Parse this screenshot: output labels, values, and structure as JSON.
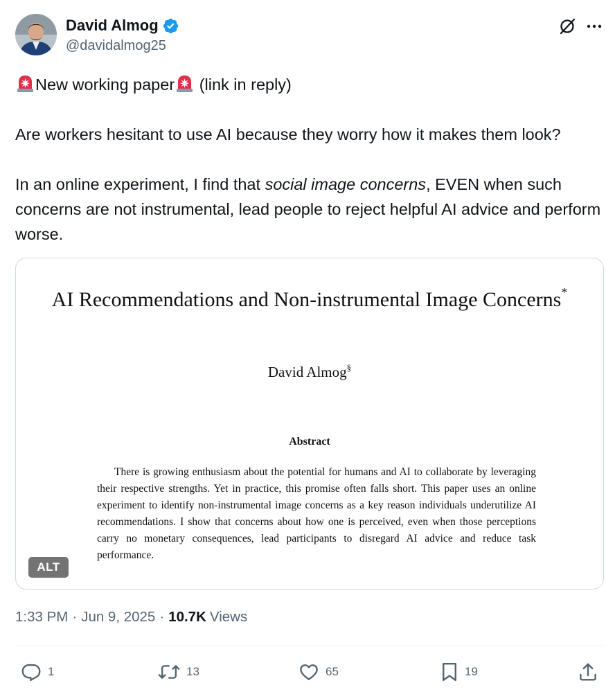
{
  "author": {
    "display_name": "David Almog",
    "handle": "@davidalmog25",
    "verified": true
  },
  "tweet": {
    "line1_text": "New working paper",
    "line1_suffix": "(link in reply)",
    "paragraph2": "Are workers hesitant to use AI because they worry how it makes them look?",
    "paragraph3_pre": "In an online experiment, I find that ",
    "paragraph3_em": "social image concerns",
    "paragraph3_post": ", EVEN when such concerns are not instrumental, lead people to reject helpful AI advice and perform worse."
  },
  "media": {
    "paper_title": "AI Recommendations and Non-instrumental Image Concerns",
    "title_mark": "*",
    "paper_author": "David Almog",
    "author_mark": "§",
    "abstract_heading": "Abstract",
    "abstract_text": "There is growing enthusiasm about the potential for humans and AI to collaborate by leveraging their respective strengths. Yet in practice, this promise often falls short. This paper uses an online experiment to identify non-instrumental image concerns as a key reason individuals underutilize AI recommendations. I show that concerns about how one is perceived, even when those perceptions carry no monetary consequences, lead participants to disregard AI advice and reduce task performance.",
    "alt_label": "ALT"
  },
  "meta": {
    "time": "1:33 PM",
    "separator": "·",
    "date": "Jun 9, 2025",
    "views_count": "10.7K",
    "views_label": "Views"
  },
  "actions": {
    "replies": "1",
    "reposts": "13",
    "likes": "65",
    "bookmarks": "19"
  },
  "icons": {
    "verified": "verified-badge-icon",
    "grok": "grok-icon",
    "more": "more-icon",
    "siren": "siren-emoji-icon",
    "reply": "reply-icon",
    "repost": "repost-icon",
    "like": "heart-icon",
    "bookmark": "bookmark-icon",
    "share": "share-icon"
  },
  "colors": {
    "text_primary": "#0f1419",
    "text_secondary": "#536471",
    "verified_blue": "#1d9bf0",
    "border": "#cfd9de",
    "siren_red": "#e0314a"
  }
}
